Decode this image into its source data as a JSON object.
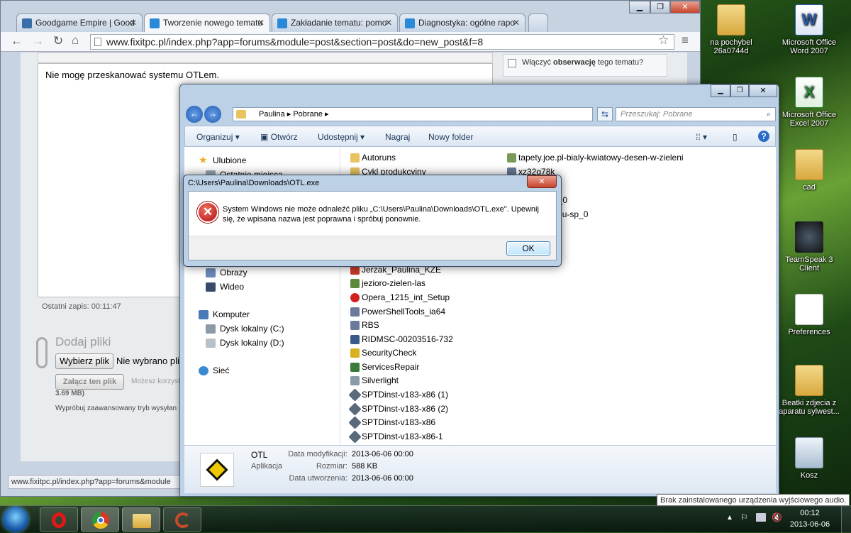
{
  "desktop": [
    {
      "label": "na pochybel\n26a0744d",
      "type": "folder"
    },
    {
      "label": "Microsoft Office\nWord 2007",
      "type": "word"
    },
    {
      "label": "Microsoft Office\nExcel 2007",
      "type": "excel"
    },
    {
      "label": "cad",
      "type": "folder"
    },
    {
      "label": "TeamSpeak 3 Client",
      "type": "ts"
    },
    {
      "label": "Preferences",
      "type": "doc"
    },
    {
      "label": "Beatki zdjecia z\naparatu sylwest...",
      "type": "folder"
    },
    {
      "label": "Kosz",
      "type": "bin"
    }
  ],
  "chrome": {
    "tabs": [
      "Goodgame Empire | Good",
      "Tworzenie nowego tematu",
      "Zakładanie tematu: pomo",
      "Diagnostyka: ogólne rapo"
    ],
    "url": "www.fixitpc.pl/index.php?app=forums&module=post&section=post&do=new_post&f=8",
    "status_url": "www.fixitpc.pl/index.php?app=forums&module",
    "page": {
      "follow_prefix": "Włączyć ",
      "follow_bold": "obserwację",
      "follow_suffix": " tego tematu?",
      "editor_text": "Nie mogę przeskanować systemu OTLem.",
      "last_save": "Ostatni zapis: 00:11:47",
      "attach_title": "Dodaj pliki",
      "choose_file": "Wybierz plik",
      "no_file": "Nie wybrano plik",
      "attach_button": "Załącz ten plik",
      "can_use": "Możesz korzyst",
      "size_limit": "3.69 MB)",
      "advanced": "Wypróbuj zaawansowany tryb wysyłan"
    }
  },
  "explorer": {
    "breadcrumb": [
      "Paulina",
      "Pobrane"
    ],
    "search_placeholder": "Przeszukaj: Pobrane",
    "commands": [
      "Organizuj",
      "Otwórz",
      "Udostępnij",
      "Nagraj",
      "Nowy folder"
    ],
    "nav": [
      "Ulubione",
      "Ostatnie miejsca",
      "Obrazy",
      "Wideo",
      "Komputer",
      "Dysk lokalny (C:)",
      "Dysk lokalny (D:)",
      "Sieć"
    ],
    "files_col1": [
      "Autoruns",
      "Cykl produkcyjny",
      "",
      "",
      "",
      "",
      "",
      "",
      "Jerzak_Paulina_KZE",
      "jezioro-zielen-las",
      "Opera_1215_int_Setup",
      "PowerShellTools_ia64",
      "RBS",
      "RIDMSC-00203516-732",
      "SecurityCheck",
      "ServicesRepair",
      "Silverlight",
      "SPTDinst-v183-x86 (1)",
      "SPTDinst-v183-x86 (2)",
      "SPTDinst-v183-x86",
      "SPTDinst-v183-x86-1"
    ],
    "files_col2": [
      "tapety.joe.pl-bialy-kwiatowy-desen-w-zieleni",
      "xz32g78k",
      "",
      "-sp_0",
      "odulu-sp_0",
      "00"
    ],
    "details": {
      "name": "OTL",
      "type": "Aplikacja",
      "modified_label": "Data modyfikacji:",
      "modified": "2013-06-06 00:00",
      "size_label": "Rozmiar:",
      "size": "588 KB",
      "created_label": "Data utworzenia:",
      "created": "2013-06-06 00:00"
    }
  },
  "dialog": {
    "title": "C:\\Users\\Paulina\\Downloads\\OTL.exe",
    "message": "System Windows nie może odnaleźć pliku „C:\\Users\\Paulina\\Downloads\\OTL.exe\". Upewnij się, że wpisana nazwa jest poprawna i spróbuj ponownie.",
    "ok": "OK"
  },
  "taskbar": {
    "time": "00:12",
    "date": "2013-06-06"
  },
  "tooltip": "Brak zainstalowanego urządzenia wyjściowego audio."
}
